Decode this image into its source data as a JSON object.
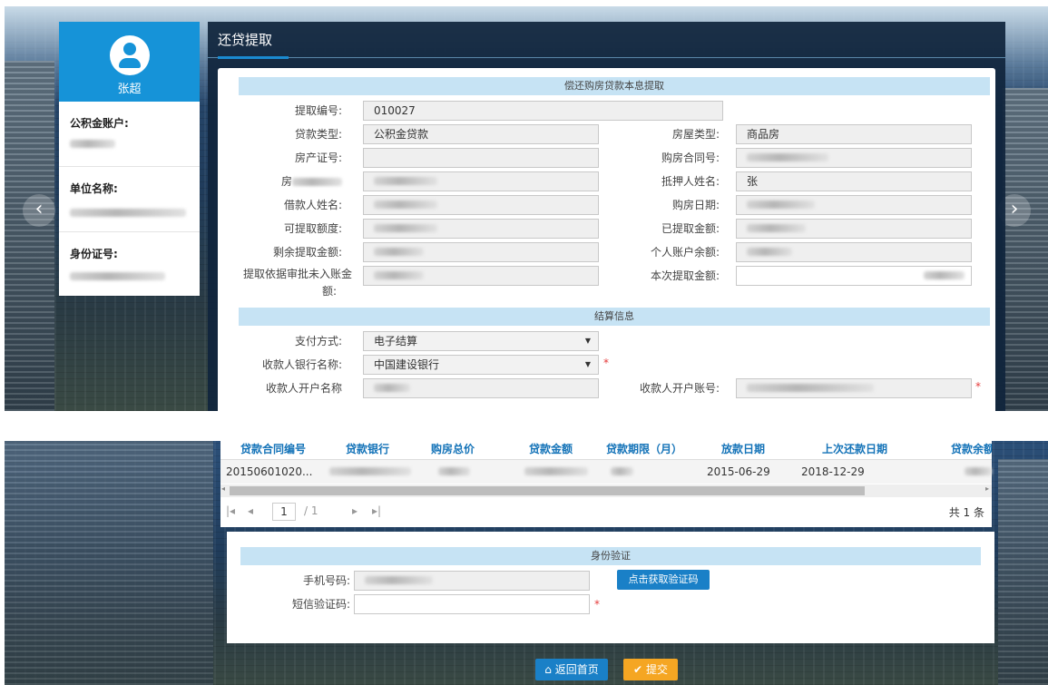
{
  "user": {
    "name": "张超"
  },
  "sidebar": {
    "account_label": "公积金账户:",
    "unit_label": "单位名称:",
    "id_label": "身份证号:"
  },
  "page": {
    "title": "还贷提取"
  },
  "section1": {
    "title": "偿还购房贷款本息提取"
  },
  "fields": {
    "withdraw_no_label": "提取编号:",
    "withdraw_no": "010027",
    "loan_type_label": "贷款类型:",
    "loan_type": "公积金贷款",
    "house_type_label": "房屋类型:",
    "house_type": "商品房",
    "property_cert_label": "房产证号:",
    "contract_no_label": "购房合同号:",
    "house_owner_label": "房",
    "mortgagor_label": "抵押人姓名:",
    "mortgagor": "张",
    "borrower_label": "借款人姓名:",
    "purchase_date_label": "购房日期:",
    "available_label": "可提取额度:",
    "withdrawn_label": "已提取金额:",
    "remaining_label": "剩余提取金额:",
    "balance_label": "个人账户余额:",
    "pending_label_1": "提取依据审批未入账金",
    "pending_label_2": "额:",
    "current_label": "本次提取金额:"
  },
  "section2": {
    "title": "结算信息"
  },
  "settlement": {
    "pay_method_label": "支付方式:",
    "pay_method": "电子结算",
    "bank_label": "收款人银行名称:",
    "bank": "中国建设银行",
    "payee_name_label": "收款人开户名称",
    "payee_account_label": "收款人开户账号:"
  },
  "table": {
    "headers": [
      "贷款合同编号",
      "贷款银行",
      "购房总价",
      "贷款金额",
      "贷款期限（月）",
      "放款日期",
      "上次还款日期",
      "贷款余额"
    ],
    "row": {
      "contract": "20150601020...",
      "loan_date": "2015-06-29",
      "last_repay": "2018-12-29"
    },
    "pager": {
      "page": "1",
      "total_pages": "/ 1",
      "total": "共 1 条"
    }
  },
  "verify": {
    "title": "身份验证",
    "phone_label": "手机号码:",
    "get_code_label": "点击获取验证码",
    "sms_label": "短信验证码:"
  },
  "actions": {
    "home_label": "返回首页",
    "submit_label": "提交"
  },
  "colors": {
    "primary": "#1693d8",
    "header_bg": "#c6e3f4",
    "submit": "#f5a623",
    "required": "#e53b3b"
  }
}
